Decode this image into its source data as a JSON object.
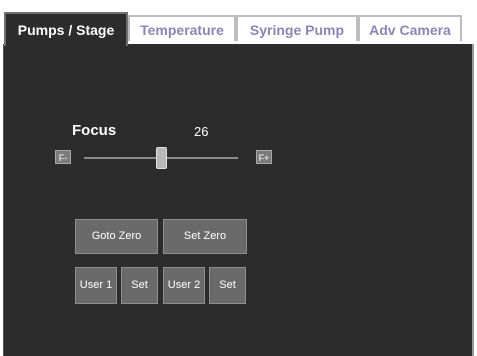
{
  "tabs": [
    {
      "label": "Pumps / Stage",
      "active": true
    },
    {
      "label": "Temperature",
      "active": false
    },
    {
      "label": "Syringe Pump",
      "active": false
    },
    {
      "label": "Adv Camera",
      "active": false
    }
  ],
  "focus": {
    "label": "Focus",
    "value": "26",
    "minus_label": "F-",
    "plus_label": "F+"
  },
  "buttons": {
    "goto_zero": "Goto Zero",
    "set_zero": "Set Zero",
    "user1": "User 1",
    "set1": "Set",
    "user2": "User 2",
    "set2": "Set"
  },
  "colors": {
    "panel_bg": "#2c2c2c",
    "inactive_tab_text": "#8a87b6",
    "button_bg": "#6a6a6a"
  }
}
